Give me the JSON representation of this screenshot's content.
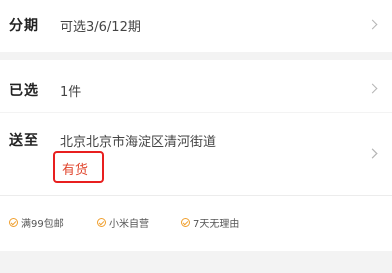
{
  "installment": {
    "label": "分期",
    "value": "可选3/6/12期"
  },
  "selected": {
    "label": "已选",
    "value": "1件"
  },
  "ship_to": {
    "label": "送至",
    "address": "北京北京市海淀区清河街道",
    "stock_status": "有货"
  },
  "services": [
    {
      "label": "满99包邮",
      "icon": "check-circle-icon"
    },
    {
      "label": "小米自营",
      "icon": "check-circle-icon"
    },
    {
      "label": "7天无理由",
      "icon": "check-circle-icon"
    }
  ],
  "colors": {
    "highlight_border": "#e81f1f",
    "stock_text": "#e0452d",
    "service_icon": "#f0a030"
  }
}
